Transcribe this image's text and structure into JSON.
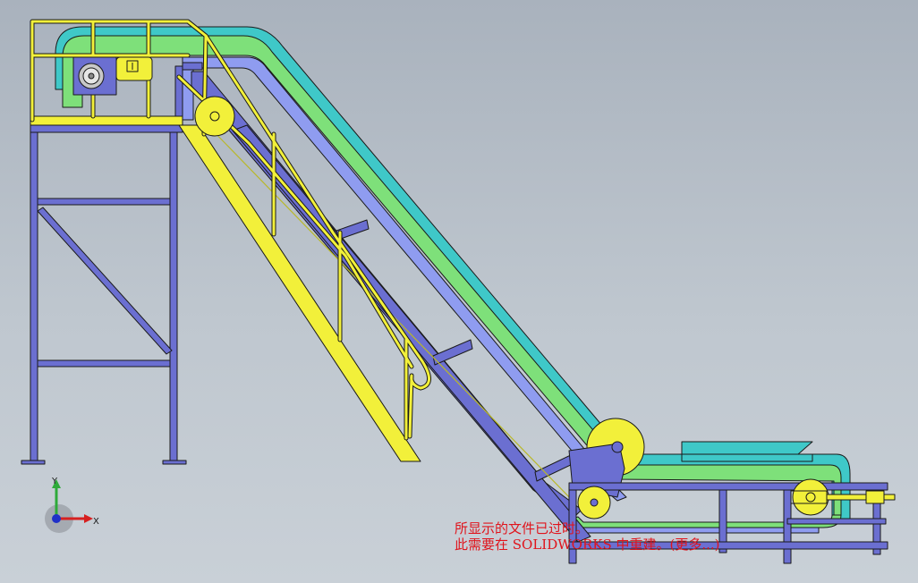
{
  "viewport": {
    "message_line1": "所显示的文件已过时。",
    "message_line2": "此需要在 SOLIDWORKS 中重建。(更多...)",
    "triad": {
      "x_label": "X",
      "y_label": "Y"
    },
    "colors": {
      "frame": "#6b6fd1",
      "belt_teal": "#3fc8c8",
      "belt_green": "#7ee07a",
      "belt_inner": "#8f9cf0",
      "rail_yellow": "#f2f03a",
      "outline": "#1a1a1a",
      "warning_text": "#e0141c"
    }
  }
}
